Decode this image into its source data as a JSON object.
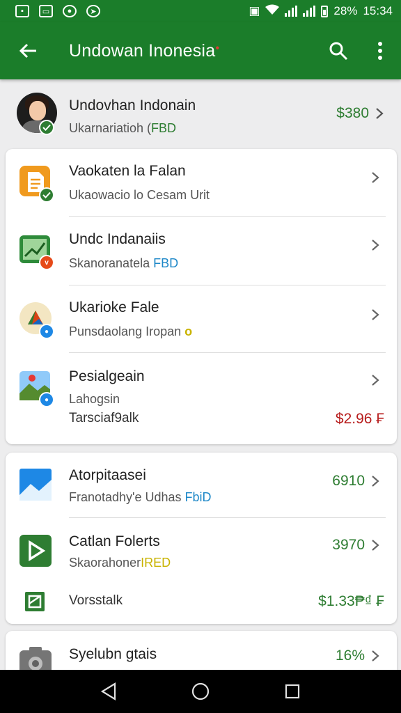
{
  "status_bar": {
    "battery": "28%",
    "time": "15:34",
    "left_icons": [
      "photo-icon",
      "tv-icon",
      "vpn-icon",
      "navigation-icon"
    ],
    "right_icons": [
      "vibrate-icon",
      "wifi-icon",
      "signal-icon",
      "signal-icon",
      "battery-icon"
    ]
  },
  "app_bar": {
    "title": "Undowan Inonesia",
    "back_icon": "arrow-back-icon",
    "search_icon": "search-icon",
    "more_icon": "more-vert-icon"
  },
  "account": {
    "name": "Undovhan Indonain",
    "subtitle_prefix": "Ukarnariatioh (",
    "subtitle_tag": "FBD",
    "amount": "$380"
  },
  "card1": {
    "items": [
      {
        "title": "Vaokaten la Falan",
        "subtitle": "Ukaowacio lo Cesam Urit",
        "subtitle_tag": "",
        "icon": "document-icon"
      },
      {
        "title": "Undc Indanaiis",
        "subtitle": "Skanoranatela ",
        "subtitle_tag": "FBD",
        "icon": "chart-icon"
      },
      {
        "title": "Ukarioke Fale",
        "subtitle": "Punsdaolang Iropan ",
        "subtitle_tag": "o",
        "icon": "drive-icon"
      },
      {
        "title": "Pesialgeain",
        "subtitle": "Lahogsin",
        "subtitle_tag": "",
        "icon": "map-icon"
      }
    ],
    "footer_label": "Tarsciaf9alk",
    "footer_amount": "$2.96 ₣"
  },
  "card2": {
    "items": [
      {
        "title": "Atorpitaasei",
        "subtitle": "Franotadhy'e Udhas ",
        "subtitle_tag": "FbiD",
        "amount": "6910",
        "icon": "photos-icon"
      },
      {
        "title": "Catlan Folerts",
        "subtitle": "Skaorahoner",
        "subtitle_tag": "IRED",
        "amount": "3970",
        "icon": "play-icon"
      }
    ],
    "footer_label": "Vorsstalk",
    "footer_amount": "$1.33₱₫ ₣"
  },
  "card3": {
    "title": "Syelubn gtais",
    "amount": "16%",
    "icon": "camera-icon"
  },
  "nav": {
    "back": "nav-back-icon",
    "home": "nav-home-icon",
    "recents": "nav-recents-icon"
  },
  "colors": {
    "primary": "#1b7d2a",
    "accent_green": "#2e7d32",
    "tag_blue": "#1e88c8",
    "tag_yellow": "#c9b300",
    "amount_red": "#b71c1c"
  }
}
